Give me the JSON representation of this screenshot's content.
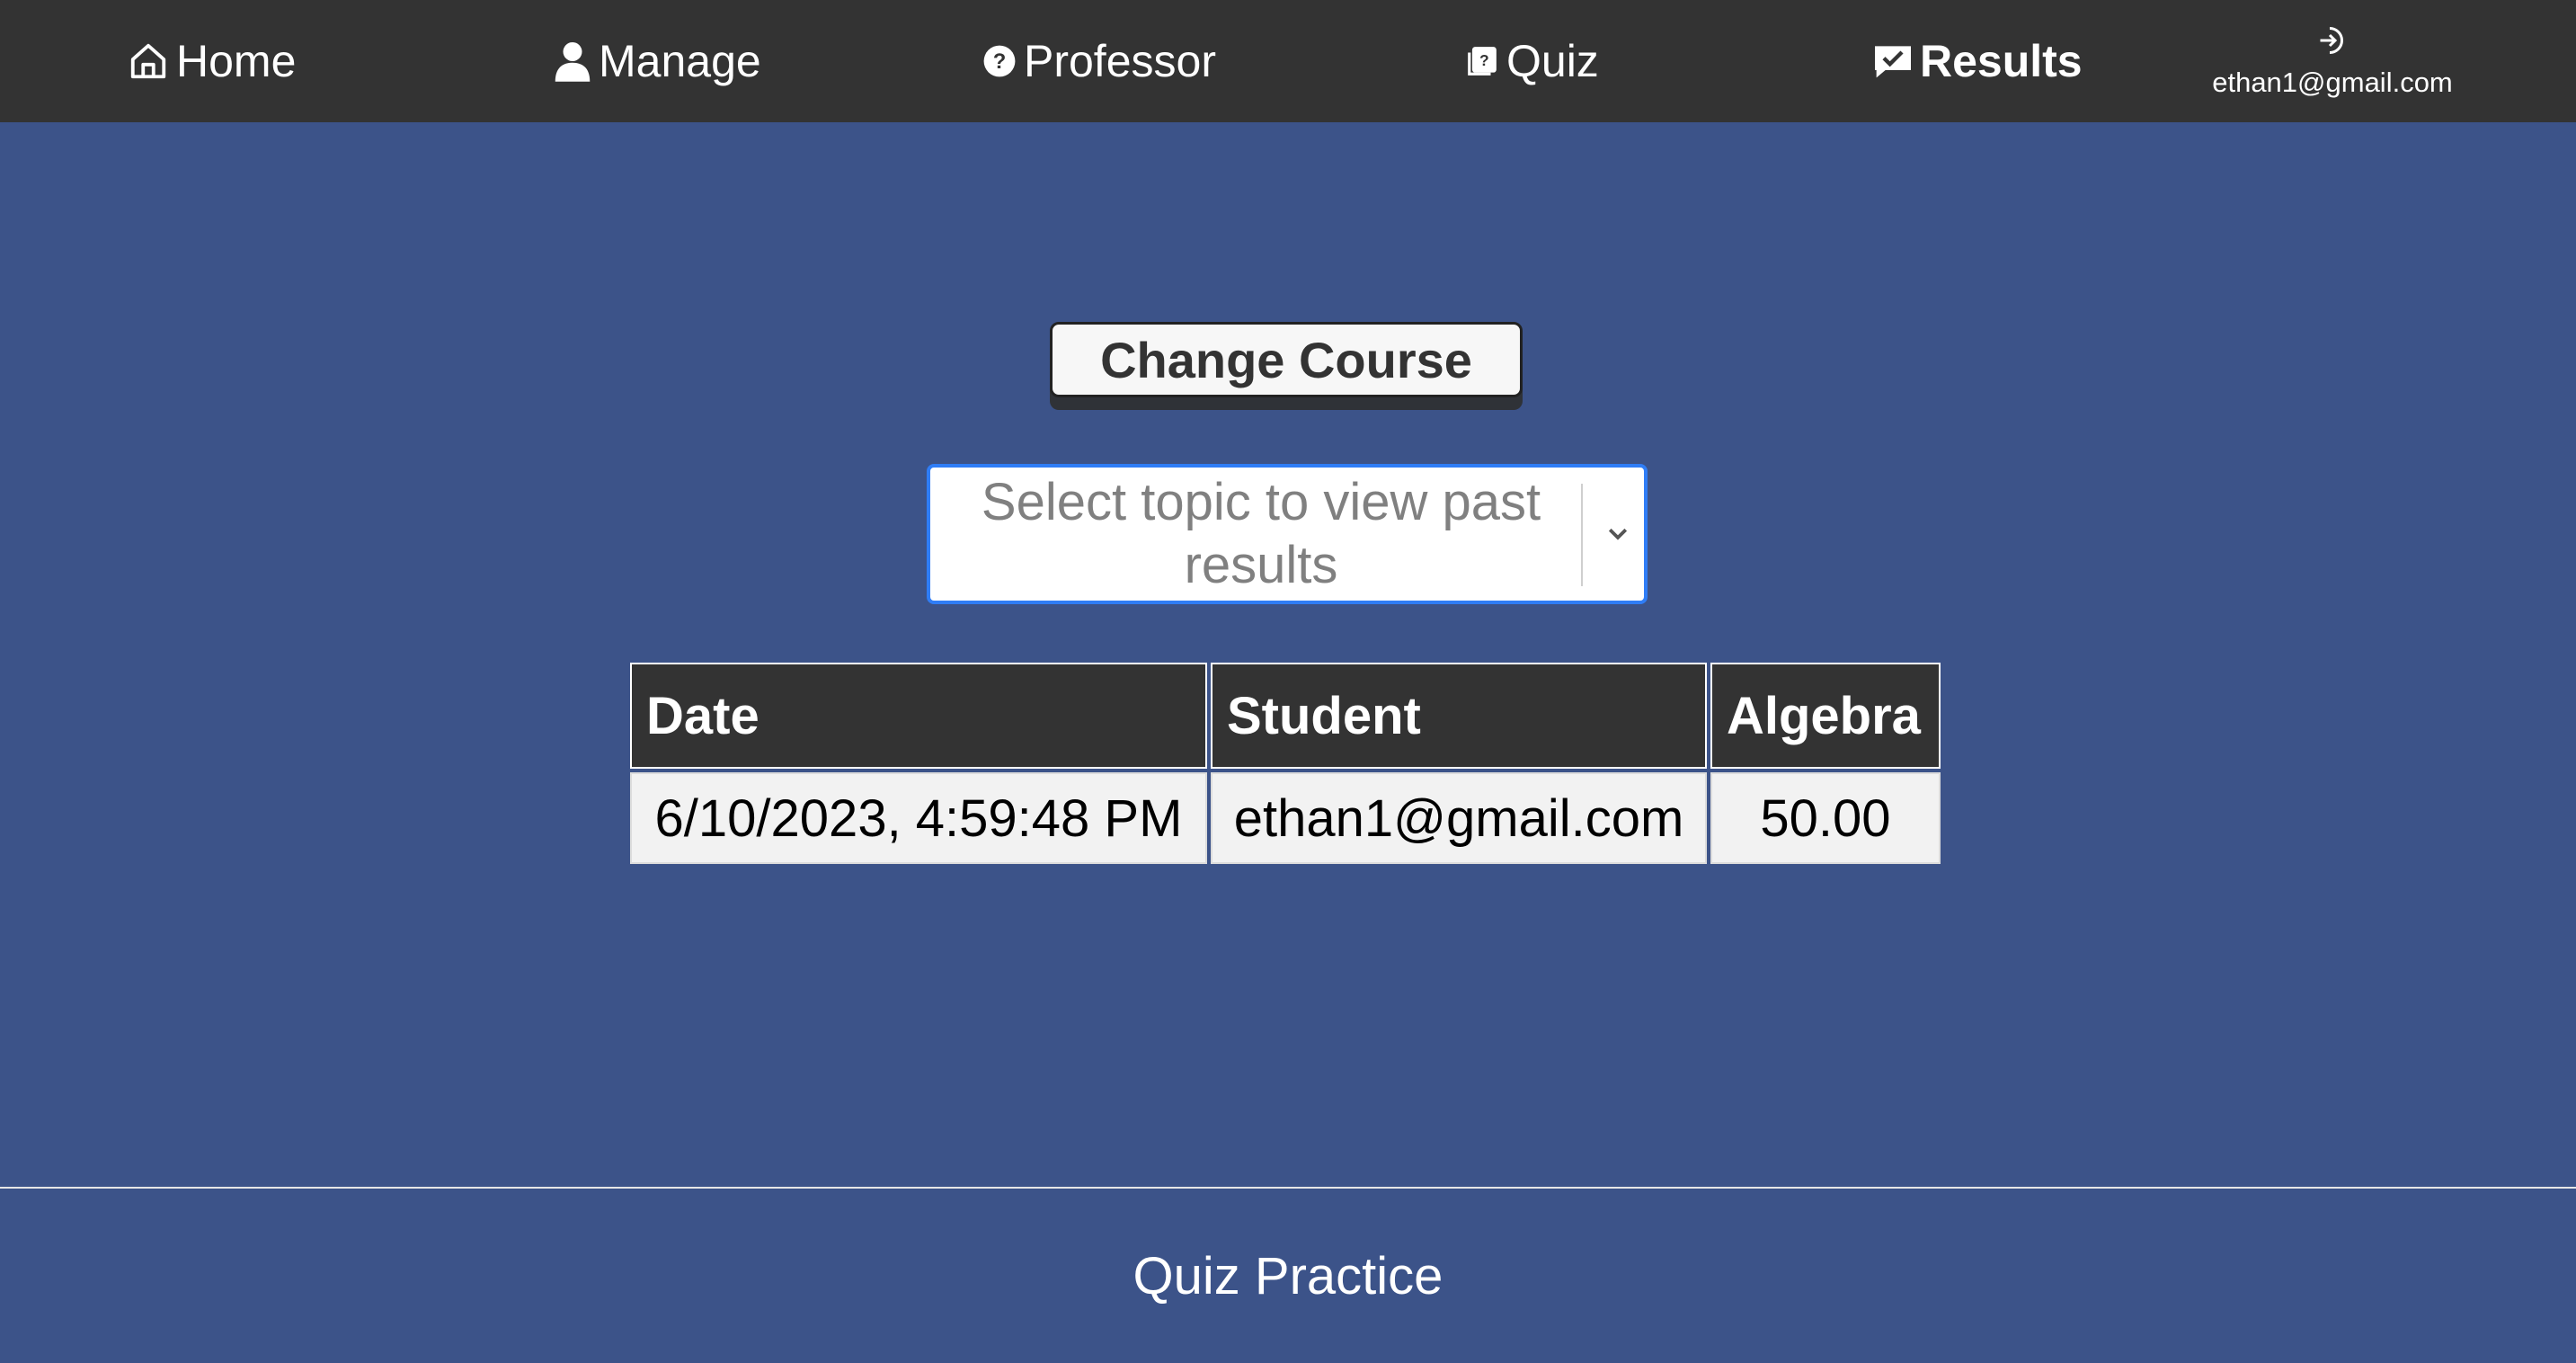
{
  "nav": {
    "home": "Home",
    "manage": "Manage",
    "professor": "Professor",
    "quiz": "Quiz",
    "results": "Results",
    "user_email": "ethan1@gmail.com"
  },
  "main": {
    "change_course_label": "Change Course",
    "topic_select_placeholder": "Select topic to view past results"
  },
  "table": {
    "headers": [
      "Date",
      "Student",
      "Algebra"
    ],
    "rows": [
      [
        "6/10/2023, 4:59:48 PM",
        "ethan1@gmail.com",
        "50.00"
      ]
    ]
  },
  "footer": {
    "title": "Quiz Practice"
  },
  "colors": {
    "nav_bg": "#333333",
    "page_bg": "#3c5389",
    "select_border": "#2f7df6"
  },
  "icons": {
    "home": "home-icon",
    "manage": "person-icon",
    "professor": "question-circle-icon",
    "quiz": "quiz-book-icon",
    "results": "chat-check-icon",
    "logout": "logout-icon",
    "select": "chevron-down-icon"
  }
}
